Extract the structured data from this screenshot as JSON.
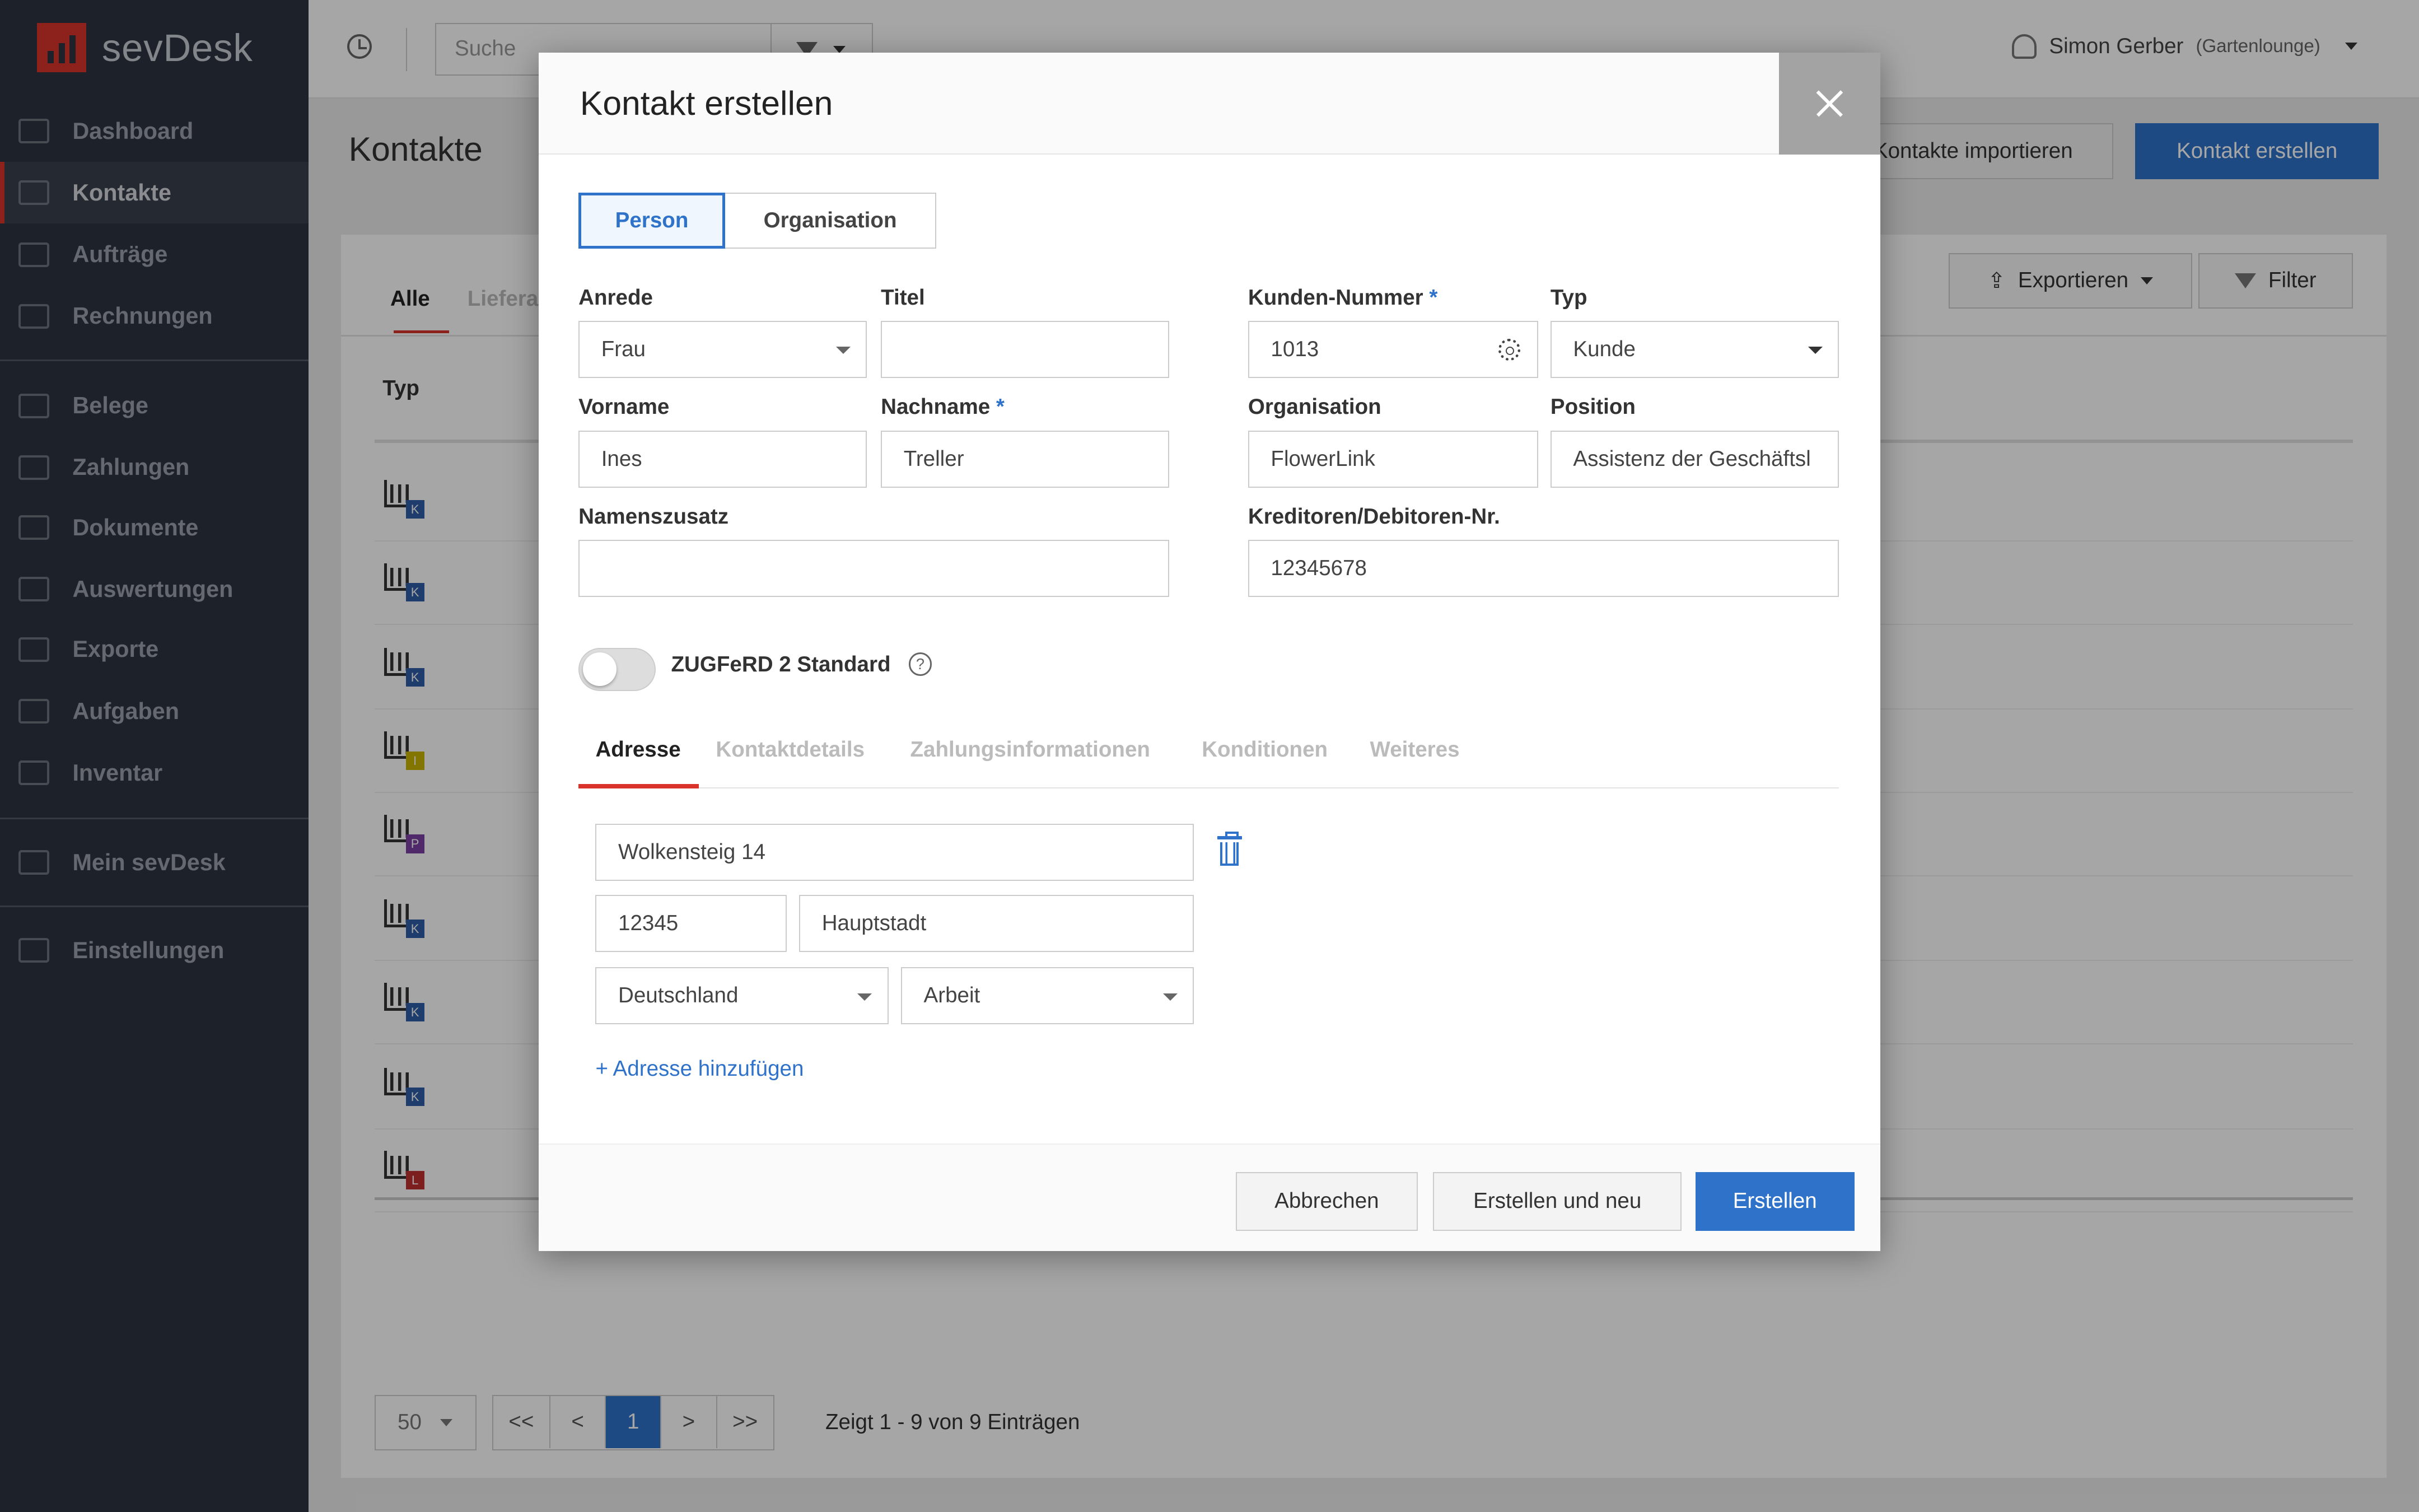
{
  "app": {
    "logo_text": "sevDesk",
    "brand_color": "#d9332b",
    "accent_color": "#2f72c9"
  },
  "sidebar": {
    "items": [
      {
        "label": "Dashboard",
        "icon": "cloud-icon"
      },
      {
        "label": "Kontakte",
        "icon": "contact-card-icon",
        "active": true
      },
      {
        "label": "Aufträge",
        "icon": "folder-icon"
      },
      {
        "label": "Rechnungen",
        "icon": "document-icon"
      },
      {
        "label": "Belege",
        "icon": "receipt-icon"
      },
      {
        "label": "Zahlungen",
        "icon": "credit-card-icon"
      },
      {
        "label": "Dokumente",
        "icon": "calendar-icon"
      },
      {
        "label": "Auswertungen",
        "icon": "wallet-icon"
      },
      {
        "label": "Exporte",
        "icon": "archive-icon"
      },
      {
        "label": "Aufgaben",
        "icon": "checkmark-icon"
      },
      {
        "label": "Inventar",
        "icon": "box-icon"
      },
      {
        "label": "Mein sevDesk",
        "icon": "bar-chart-icon"
      },
      {
        "label": "Einstellungen",
        "icon": "gear-icon"
      }
    ]
  },
  "topbar": {
    "search_placeholder": "Suche",
    "user_name": "Simon Gerber",
    "user_company": "(Gartenlounge)"
  },
  "page": {
    "title": "Kontakte",
    "import_button": "Kontakte importieren",
    "create_button": "Kontakt erstellen",
    "tab_all": "Alle",
    "tab_lieferanten": "Liefera",
    "col_typ": "Typ",
    "export_button": "Exportieren",
    "filter_button": "Filter",
    "rows": [
      {
        "badge": "K",
        "color": "#2f5fa8"
      },
      {
        "badge": "K",
        "color": "#2f5fa8"
      },
      {
        "badge": "K",
        "color": "#2f5fa8"
      },
      {
        "badge": "I",
        "color": "#c8b400"
      },
      {
        "badge": "P",
        "color": "#7a3fa3"
      },
      {
        "badge": "K",
        "color": "#2f5fa8"
      },
      {
        "badge": "K",
        "color": "#2f5fa8"
      },
      {
        "badge": "K",
        "color": "#2f5fa8"
      },
      {
        "badge": "L",
        "color": "#c03030"
      }
    ],
    "pager": {
      "page_size": "50",
      "first": "<<",
      "prev": "<",
      "current": "1",
      "next": ">",
      "last": ">>",
      "info": "Zeigt 1 - 9 von 9 Einträgen"
    }
  },
  "modal": {
    "title": "Kontakt erstellen",
    "seg_person": "Person",
    "seg_org": "Organisation",
    "labels": {
      "anrede": "Anrede",
      "titel": "Titel",
      "vorname": "Vorname",
      "nachname": "Nachname",
      "namenszusatz": "Namenszusatz",
      "kundennummer": "Kunden-Nummer",
      "typ": "Typ",
      "organisation": "Organisation",
      "position": "Position",
      "kreditoren": "Kreditoren/Debitoren-Nr.",
      "required_mark": "*"
    },
    "values": {
      "anrede": "Frau",
      "titel": "",
      "vorname": "Ines",
      "nachname": "Treller",
      "namenszusatz": "",
      "kundennummer": "1013",
      "typ": "Kunde",
      "organisation": "FlowerLink",
      "position": "Assistenz der Geschäftsl",
      "kreditoren": "12345678"
    },
    "toggle_label": "ZUGFeRD 2 Standard",
    "help_glyph": "?",
    "subtabs": [
      "Adresse",
      "Kontaktdetails",
      "Zahlungsinformationen",
      "Konditionen",
      "Weiteres"
    ],
    "address": {
      "street": "Wolkensteig 14",
      "zip": "12345",
      "city": "Hauptstadt",
      "country": "Deutschland",
      "category": "Arbeit"
    },
    "add_address": "+ Adresse hinzufügen",
    "buttons": {
      "cancel": "Abbrechen",
      "create_new": "Erstellen und neu",
      "create": "Erstellen"
    }
  }
}
